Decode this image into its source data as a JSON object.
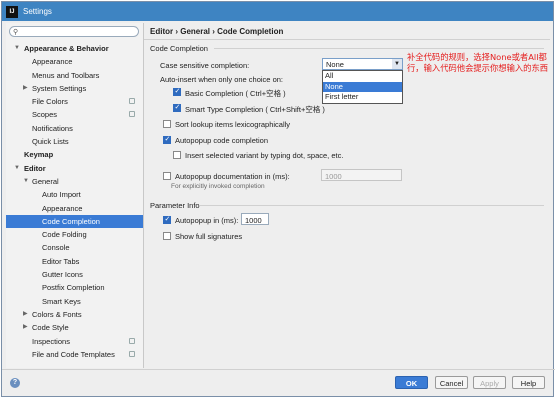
{
  "window": {
    "title": "Settings",
    "app_badge": "IJ"
  },
  "sidebar": {
    "search_placeholder": "",
    "items": [
      {
        "label": "Appearance & Behavior",
        "level": 0,
        "arrow": "▼",
        "bold": true
      },
      {
        "label": "Appearance",
        "level": 1
      },
      {
        "label": "Menus and Toolbars",
        "level": 1
      },
      {
        "label": "System Settings",
        "level": 1,
        "arrow": "▶"
      },
      {
        "label": "File Colors",
        "level": 1,
        "cfg": true
      },
      {
        "label": "Scopes",
        "level": 1,
        "cfg": true
      },
      {
        "label": "Notifications",
        "level": 1
      },
      {
        "label": "Quick Lists",
        "level": 1
      },
      {
        "label": "Keymap",
        "level": 0,
        "bold": true
      },
      {
        "label": "Editor",
        "level": 0,
        "arrow": "▼",
        "bold": true
      },
      {
        "label": "General",
        "level": 1,
        "arrow": "▼"
      },
      {
        "label": "Auto Import",
        "level": 2
      },
      {
        "label": "Appearance",
        "level": 2
      },
      {
        "label": "Code Completion",
        "level": 2,
        "selected": true
      },
      {
        "label": "Code Folding",
        "level": 2
      },
      {
        "label": "Console",
        "level": 2
      },
      {
        "label": "Editor Tabs",
        "level": 2
      },
      {
        "label": "Gutter Icons",
        "level": 2
      },
      {
        "label": "Postfix Completion",
        "level": 2
      },
      {
        "label": "Smart Keys",
        "level": 2
      },
      {
        "label": "Colors & Fonts",
        "level": 1,
        "arrow": "▶"
      },
      {
        "label": "Code Style",
        "level": 1,
        "arrow": "▶"
      },
      {
        "label": "Inspections",
        "level": 1,
        "cfg": true
      },
      {
        "label": "File and Code Templates",
        "level": 1,
        "cfg": true
      }
    ]
  },
  "content": {
    "breadcrumb": "Editor › General › Code Completion",
    "section_code_completion": "Code Completion",
    "case_sensitive_label": "Case sensitive completion:",
    "case_sensitive_value": "None",
    "dropdown_options": [
      "All",
      "None",
      "First letter"
    ],
    "dropdown_highlight": 1,
    "auto_insert_label": "Auto-insert when only one choice on:",
    "basic_completion": {
      "label": "Basic Completion ( Ctrl+空格 )",
      "checked": true
    },
    "smart_completion": {
      "label": "Smart Type Completion ( Ctrl+Shift+空格 )",
      "checked": true
    },
    "sort_lexico": {
      "label": "Sort lookup items lexicographically",
      "checked": false
    },
    "autopopup_completion": {
      "label": "Autopopup code completion",
      "checked": true
    },
    "insert_selected": {
      "label": "Insert selected variant by typing dot, space, etc.",
      "checked": false
    },
    "autopopup_doc": {
      "label": "Autopopup documentation in (ms):",
      "checked": false,
      "value": "1000"
    },
    "autopopup_doc_hint": "For explicitly invoked completion",
    "section_parameter_info": "Parameter Info",
    "param_autopopup": {
      "label": "Autopopup in (ms):",
      "checked": true,
      "value": "1000"
    },
    "show_full_signatures": {
      "label": "Show full signatures",
      "checked": false
    }
  },
  "annotation": "补全代码的规则，选择None或者All都行，输入代码他会提示你想输入的东西",
  "footer": {
    "ok": "OK",
    "cancel": "Cancel",
    "apply": "Apply",
    "help": "Help",
    "help_icon_glyph": "?"
  },
  "colors": {
    "accent": "#3a7bd5",
    "titlebar": "#3e84c2",
    "annotation": "#e52020"
  }
}
